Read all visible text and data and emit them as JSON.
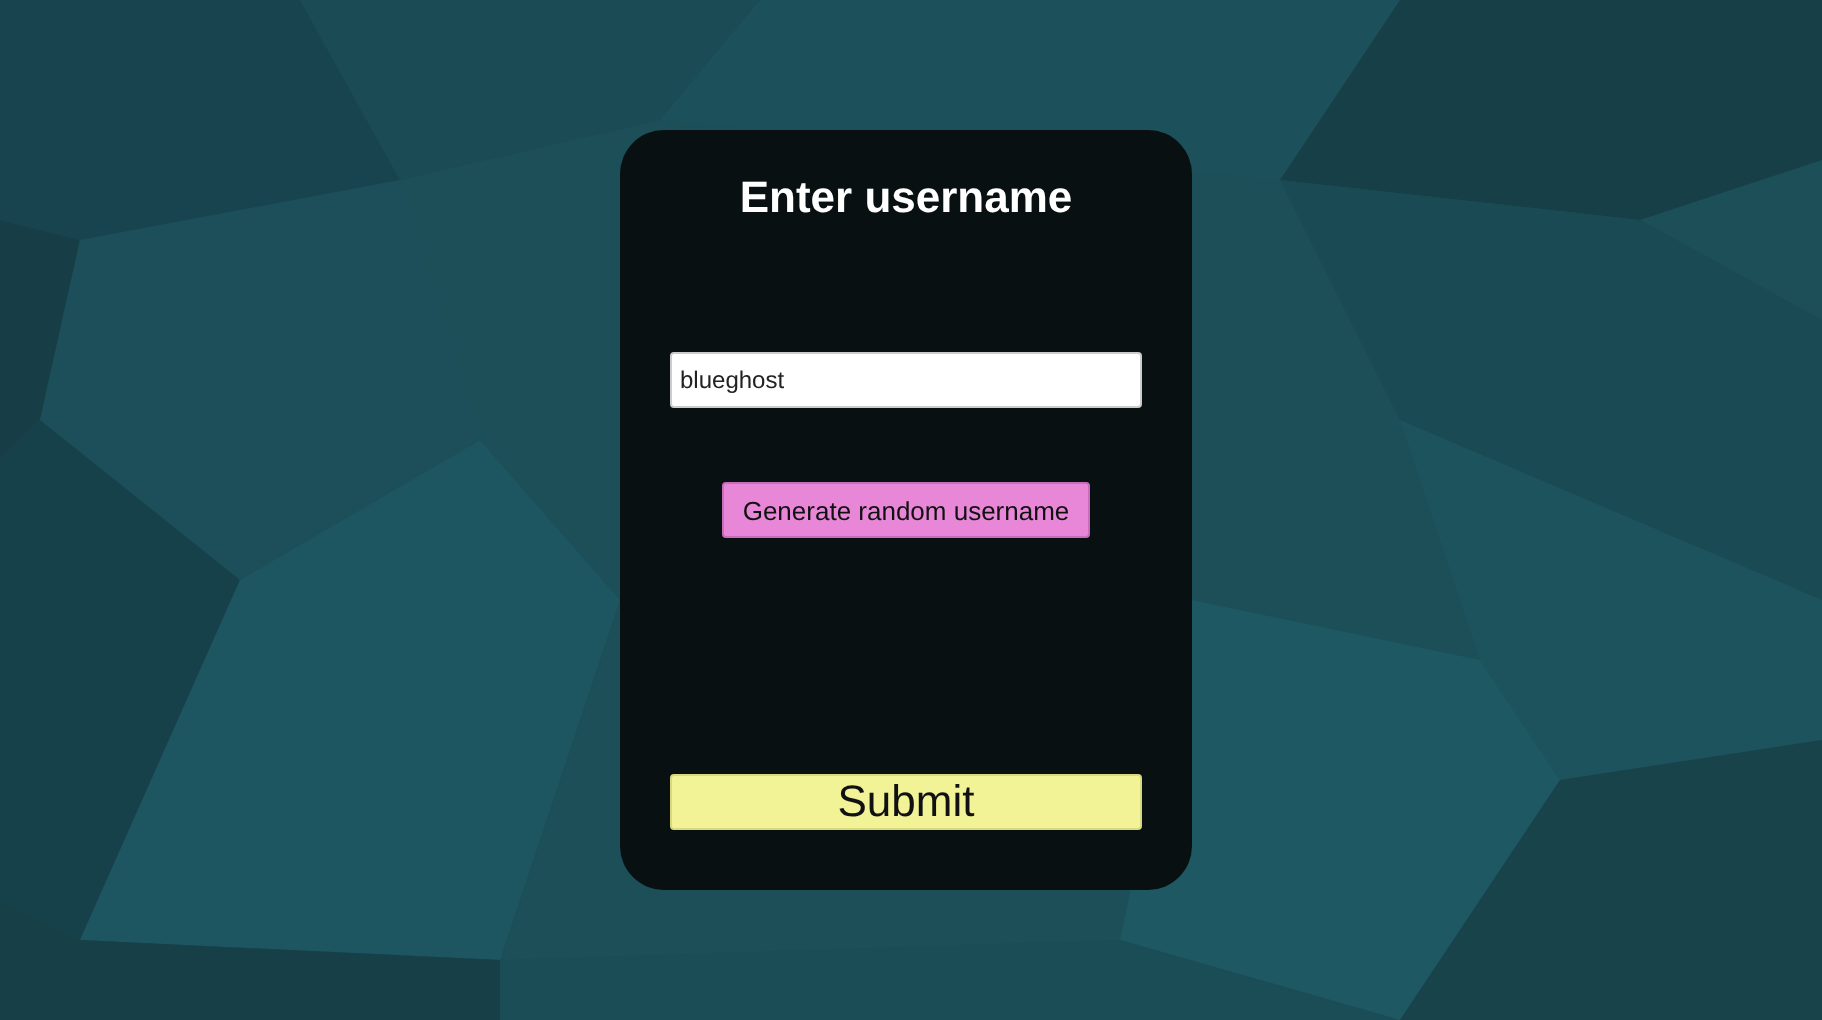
{
  "title": "Enter username",
  "username_field": {
    "value": "blueghost"
  },
  "generate_button": {
    "label": "Generate random username"
  },
  "submit_button": {
    "label": "Submit"
  }
}
